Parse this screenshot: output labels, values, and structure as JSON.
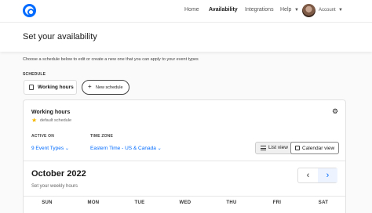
{
  "nav": {
    "links": [
      "Home",
      "Availability",
      "Integrations",
      "Help"
    ],
    "active": "Availability",
    "account_label": "Account"
  },
  "header": {
    "title": "Set your availability"
  },
  "instructions": "Choose a schedule below to edit or create a new one that you can apply to your event types",
  "schedule": {
    "section_label": "SCHEDULE",
    "active_tab": "Working hours",
    "new_button": "New schedule"
  },
  "card": {
    "title": "Working hours",
    "default_text": "default schedule",
    "active_on_label": "ACTIVE ON",
    "active_on_value": "9 Event Types",
    "time_zone_label": "TIME ZONE",
    "time_zone_value": "Eastern Time - US & Canada",
    "list_view": "List view",
    "calendar_view": "Calendar view",
    "month": "October 2022",
    "subtitle": "Set your weekly hours",
    "weekdays": [
      "SUN",
      "MON",
      "TUE",
      "WED",
      "THU",
      "FRI",
      "SAT"
    ]
  },
  "colors": {
    "accent": "#006bff",
    "star": "#f5b700"
  }
}
